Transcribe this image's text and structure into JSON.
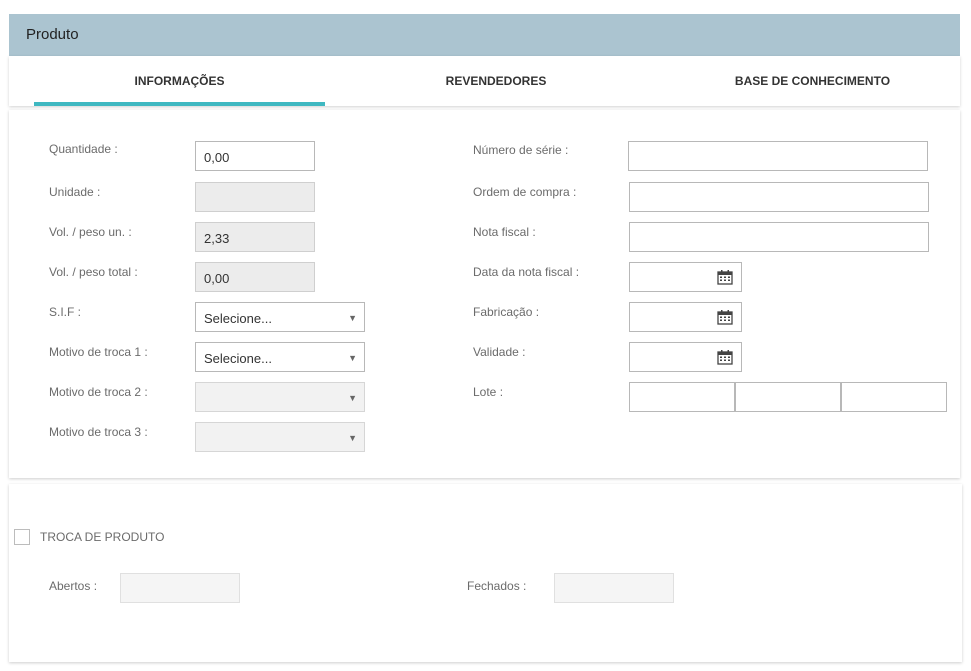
{
  "header": {
    "title": "Produto"
  },
  "tabs": [
    {
      "label": "INFORMAÇÕES",
      "active": true
    },
    {
      "label": "REVENDEDORES",
      "active": false
    },
    {
      "label": "BASE DE CONHECIMENTO",
      "active": false
    }
  ],
  "left_form": {
    "quantidade_label": "Quantidade :",
    "quantidade_value": "0,00",
    "unidade_label": "Unidade :",
    "unidade_value": "",
    "vol_peso_un_label": "Vol. / peso un. :",
    "vol_peso_un_value": "2,33",
    "vol_peso_total_label": "Vol. / peso total :",
    "vol_peso_total_value": "0,00",
    "sif_label": "S.I.F :",
    "sif_value": "Selecione...",
    "motivo1_label": "Motivo de troca 1 :",
    "motivo1_value": "Selecione...",
    "motivo2_label": "Motivo de troca 2 :",
    "motivo2_value": "",
    "motivo3_label": "Motivo de troca 3 :",
    "motivo3_value": ""
  },
  "right_form": {
    "numero_serie_label": "Número de série :",
    "numero_serie_value": "",
    "ordem_compra_label": "Ordem de compra :",
    "ordem_compra_value": "",
    "nota_fiscal_label": "Nota fiscal :",
    "nota_fiscal_value": "",
    "data_nota_label": "Data da nota fiscal :",
    "data_nota_value": "",
    "fabricacao_label": "Fabricação :",
    "fabricacao_value": "",
    "validade_label": "Validade :",
    "validade_value": "",
    "lote_label": "Lote :",
    "lote_values": [
      "",
      "",
      ""
    ]
  },
  "troca": {
    "checkbox_label": "TROCA DE PRODUTO",
    "checked": false,
    "abertos_label": "Abertos :",
    "abertos_value": "",
    "fechados_label": "Fechados :",
    "fechados_value": ""
  },
  "icons": {
    "calendar": "calendar-icon",
    "dropdown": "chevron-down-icon"
  },
  "colors": {
    "header_bg": "#abc4d0",
    "tab_accent": "#3fb8c1"
  }
}
